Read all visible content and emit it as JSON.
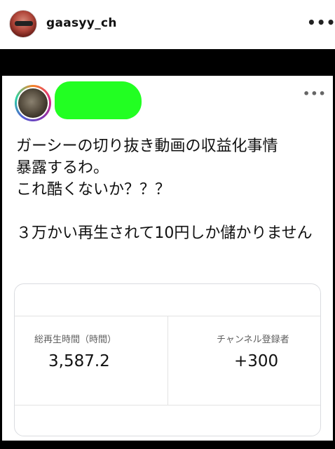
{
  "header": {
    "username": "gaasyy_ch",
    "more_label": "•••"
  },
  "post": {
    "more_label": "•••",
    "text": "ガーシーの切り抜き動画の収益化事情\n暴露するわ。\nこれ酷くないか？？？\n\n３万かい再生されて10円しか儲かりません"
  },
  "stats": {
    "watch_time_label": "総再生時間（時間）",
    "watch_time_value": "3,587.2",
    "subscribers_label": "チャンネル登録者",
    "subscribers_value": "+300"
  },
  "colors": {
    "redaction": "#22ff22",
    "band": "#000000"
  }
}
